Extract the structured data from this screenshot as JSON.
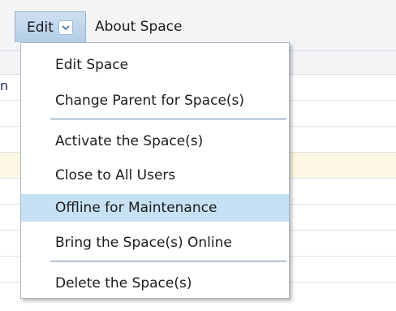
{
  "toolbar": {
    "edit_label": "Edit",
    "about_label": "About Space"
  },
  "background": {
    "clipped_text": "n"
  },
  "edit_menu": {
    "items": [
      {
        "label": "Edit Space"
      },
      {
        "label": "Change Parent for Space(s)"
      },
      {
        "label": "Activate the Space(s)"
      },
      {
        "label": "Close to All Users"
      },
      {
        "label": "Offline for Maintenance",
        "selected": true
      },
      {
        "label": "Bring the Space(s) Online"
      },
      {
        "label": "Delete the Space(s)"
      }
    ]
  },
  "colors": {
    "selected_item": "#c6e1f4",
    "menu_button": "#b3cde6",
    "row_highlight": "#fdf8e3"
  },
  "icons": {
    "edit_dropdown": "chevron-down-icon"
  }
}
